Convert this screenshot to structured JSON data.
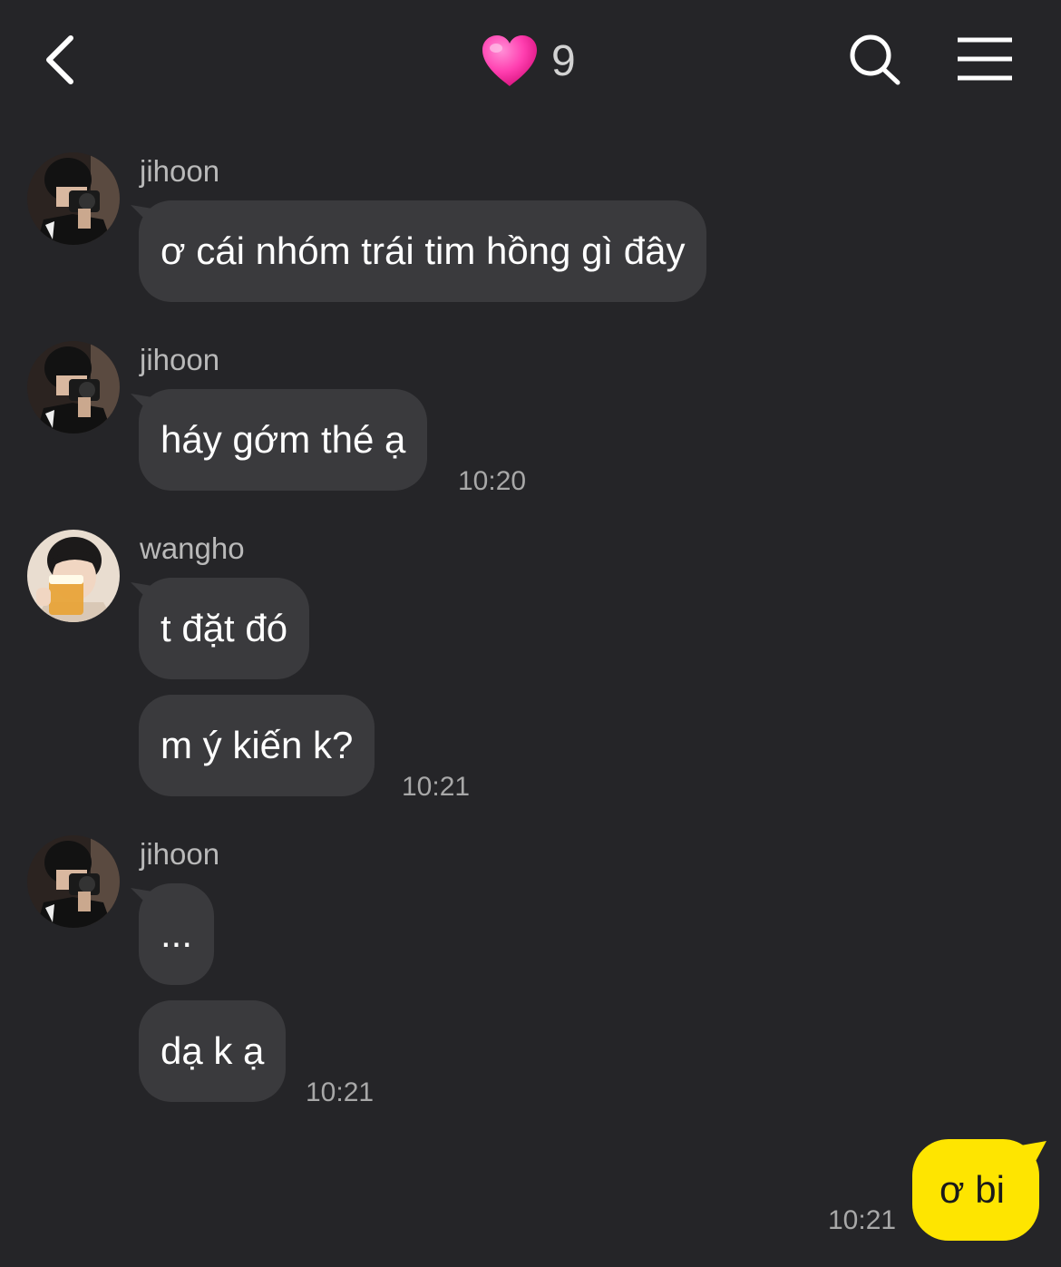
{
  "header": {
    "title_icon": "pink-heart-icon",
    "member_count": "9",
    "back_icon": "chevron-left-icon",
    "search_icon": "search-icon",
    "menu_icon": "hamburger-menu-icon"
  },
  "messages": [
    {
      "sender": "jihoon",
      "text": "ơ cái nhóm trái tim hồng gì đây"
    },
    {
      "sender": "jihoon",
      "text": "háy gớm thé ạ",
      "time": "10:20"
    },
    {
      "sender": "wangho",
      "text": "t đặt đó"
    },
    {
      "text": "m ý kiến k?",
      "time": "10:21"
    },
    {
      "sender": "jihoon",
      "text": "..."
    },
    {
      "text": "dạ k ạ",
      "time": "10:21"
    },
    {
      "text": "ơ bi",
      "time": "10:21",
      "mine": true
    }
  ],
  "colors": {
    "background": "#252528",
    "incoming_bubble": "#3a3a3d",
    "outgoing_bubble": "#fee500",
    "heart": "#ff3fb0"
  }
}
